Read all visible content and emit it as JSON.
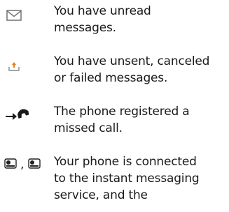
{
  "entries": [
    {
      "icon": "envelope-icon",
      "lines": [
        "You have unread",
        "messages."
      ]
    },
    {
      "icon": "outbox-upload-icon",
      "lines": [
        "You have unsent, canceled",
        "or failed messages."
      ]
    },
    {
      "icon": "missed-call-icon",
      "lines": [
        "The phone registered a",
        "missed call."
      ]
    },
    {
      "icon": "im-connection-status-icons",
      "separator": ",",
      "lines": [
        "Your phone is connected",
        "to the instant messaging",
        "service, and the"
      ]
    }
  ]
}
